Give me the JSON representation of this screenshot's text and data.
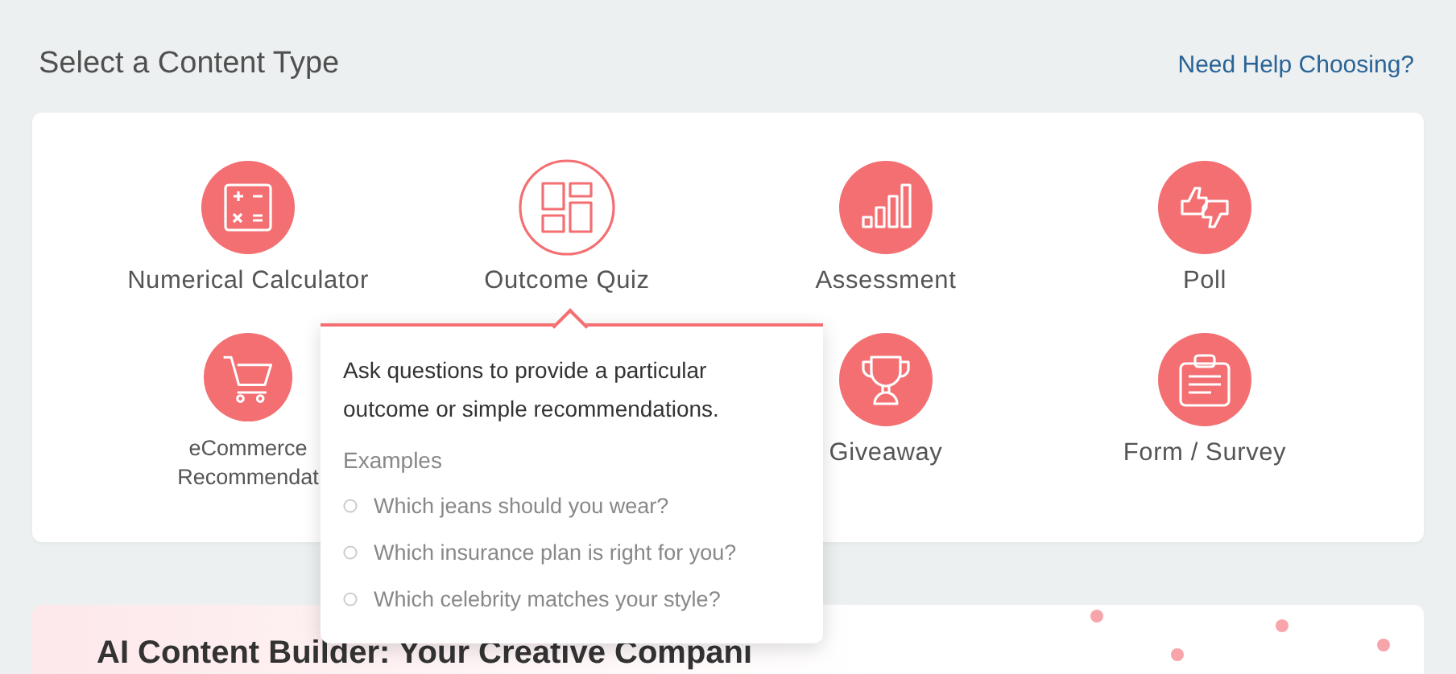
{
  "header": {
    "title": "Select a Content Type",
    "help_link": "Need Help Choosing?"
  },
  "content_types": {
    "rows": [
      [
        {
          "label": "Numerical Calculator",
          "kind": "calculator",
          "selected": false
        },
        {
          "label": "Outcome Quiz",
          "kind": "quiz",
          "selected": true
        },
        {
          "label": "Assessment",
          "kind": "assessment",
          "selected": false
        },
        {
          "label": "Poll",
          "kind": "poll",
          "selected": false
        }
      ],
      [
        {
          "label": "eCommerce Recommendat",
          "kind": "ecommerce",
          "selected": false
        },
        "",
        {
          "label": "Giveaway",
          "kind": "giveaway",
          "selected": false
        },
        {
          "label": "Form / Survey",
          "kind": "form",
          "selected": false
        }
      ]
    ]
  },
  "popover": {
    "description": "Ask questions to provide a particular outcome or simple recommendations.",
    "examples_heading": "Examples",
    "examples": [
      "Which jeans should you wear?",
      "Which insurance plan is right for you?",
      "Which celebrity matches your style?"
    ]
  },
  "promo": {
    "title": "AI Content Builder: Your Creative Compani"
  }
}
